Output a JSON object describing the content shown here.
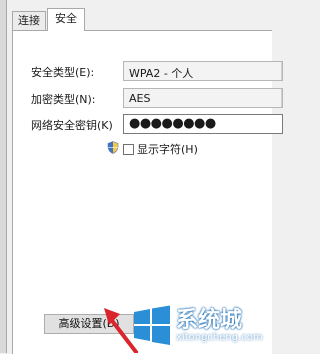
{
  "tabs": [
    {
      "label": "连接",
      "active": false
    },
    {
      "label": "安全",
      "active": true
    }
  ],
  "security": {
    "type_label": "安全类型(E):",
    "type_value": "WPA2 - 个人",
    "encryption_label": "加密类型(N):",
    "encryption_value": "AES",
    "key_label": "网络安全密钥(K)",
    "key_value": "●●●●●●●●",
    "show_chars_label": "显示字符(H)",
    "show_chars_checked": false
  },
  "advanced_button_label": "高级设置(D)",
  "watermark": {
    "title": "系统城",
    "url": "xitongcheng.com"
  },
  "colors": {
    "accent": "#1f6fb5",
    "arrow": "#d9252b"
  }
}
